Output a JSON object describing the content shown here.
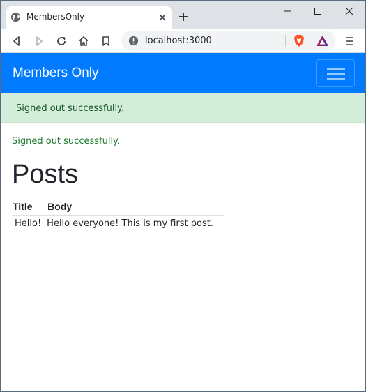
{
  "browser": {
    "tab_title": "MembersOnly",
    "url": "localhost:3000",
    "icons": {
      "favicon": "globe-icon",
      "tab_close": "close-icon",
      "new_tab": "plus-icon",
      "back": "back-arrow-icon",
      "forward": "forward-arrow-icon",
      "reload": "reload-icon",
      "home": "home-icon",
      "bookmark": "bookmark-icon",
      "site_info": "info-icon",
      "brave_shields": "brave-lion-icon",
      "rewards": "bat-triangle-icon",
      "menu": "hamburger-menu-icon"
    }
  },
  "navbar": {
    "brand": "Members Only",
    "color": "#007bff"
  },
  "alert": {
    "text": "Signed out successfully.",
    "color": "#d4edda"
  },
  "notice": "Signed out successfully.",
  "page": {
    "title": "Posts"
  },
  "table": {
    "headers": [
      "Title",
      "Body"
    ],
    "rows": [
      {
        "title": "Hello!",
        "body": "Hello everyone! This is my first post."
      }
    ]
  }
}
